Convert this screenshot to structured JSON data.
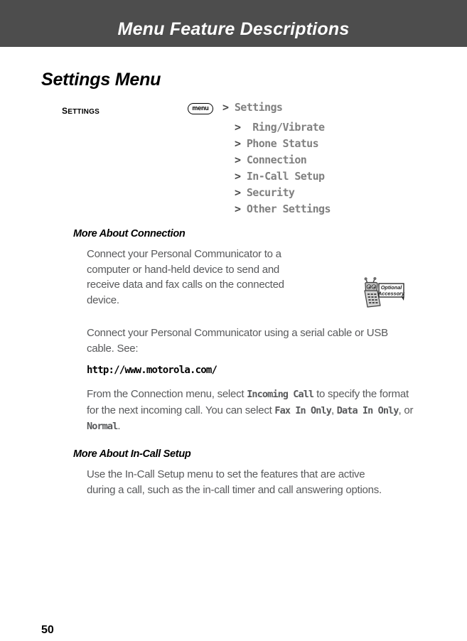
{
  "header": {
    "running_title": "Menu Feature Descriptions",
    "bar_color": "#4d4d4d",
    "text_color": "#ffffff"
  },
  "page": {
    "section_title": "Settings Menu",
    "folio": "50",
    "body_text_color": "#58595b",
    "menu_text_color": "#808080"
  },
  "menu_path": {
    "entry_label": "SETTINGS",
    "key_icon_label": "menu",
    "key_icon_name": "menu-key-icon",
    "caret": ">",
    "root_item": "Settings",
    "items": [
      "Ring/Vibrate",
      "Phone Status",
      "Connection",
      "In-Call Setup",
      "Security",
      "Other Settings"
    ]
  },
  "sections": [
    {
      "heading": "More About Connection",
      "paragraphs": [
        {
          "kind": "plain",
          "text": "Connect your Personal Communicator to a computer or hand-held device to send and receive data and fax calls on the connected device."
        },
        {
          "kind": "plain",
          "text": "Connect your Personal Communicator using a serial cable or USB cable. See:"
        },
        {
          "kind": "url",
          "text": "http://www.motorola.com/"
        },
        {
          "kind": "rich",
          "lead": "From the Connection menu, select ",
          "term1": "Incoming Call",
          "mid": " to specify the format for the next incoming call. You can select ",
          "term2": "Fax In Only",
          "sep1": ", ",
          "term3": "Data In Only",
          "sep2": ", or ",
          "term4": "Normal",
          "tail": "."
        }
      ]
    },
    {
      "heading": "More About In-Call Setup",
      "paragraphs": [
        {
          "kind": "plain",
          "text": "Use the In-Call Setup menu to set the features that are active during a call, such as the in-call timer and call answering options."
        }
      ]
    }
  ],
  "accessory_graphic": {
    "name": "optional-accessory-icon",
    "line1": "Optional",
    "line2": "Accessory"
  }
}
